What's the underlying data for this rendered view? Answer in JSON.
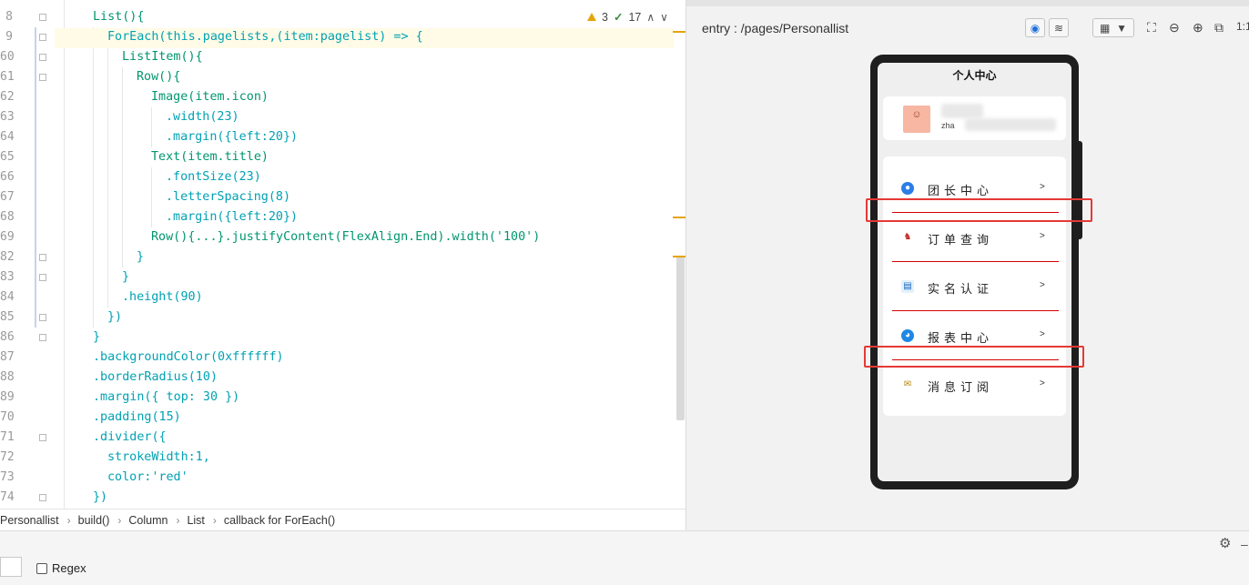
{
  "editor": {
    "status": {
      "warnings": "3",
      "checks": "17"
    },
    "lines": [
      {
        "no": "8",
        "html": "List(){"
      },
      {
        "no": "9",
        "html": "ForEach(this.pagelists,(item:pagelist) => {"
      },
      {
        "no": "60",
        "html": "ListItem(){"
      },
      {
        "no": "61",
        "html": "Row(){"
      },
      {
        "no": "62",
        "html": "Image(item.icon)"
      },
      {
        "no": "63",
        "html": ".width(23)"
      },
      {
        "no": "64",
        "html": ".margin({left:20})"
      },
      {
        "no": "65",
        "html": "Text(item.title)"
      },
      {
        "no": "66",
        "html": ".fontSize(23)"
      },
      {
        "no": "67",
        "html": ".letterSpacing(8)"
      },
      {
        "no": "68",
        "html": ".margin({left:20})"
      },
      {
        "no": "69",
        "html": "Row(){...}.justifyContent(FlexAlign.End).width('100')"
      },
      {
        "no": "82",
        "html": "}"
      },
      {
        "no": "83",
        "html": "}"
      },
      {
        "no": "84",
        "html": ".height(90)"
      },
      {
        "no": "85",
        "html": "})"
      },
      {
        "no": "86",
        "html": "}"
      },
      {
        "no": "87",
        "html": ".backgroundColor(0xffffff)"
      },
      {
        "no": "88",
        "html": ".borderRadius(10)"
      },
      {
        "no": "89",
        "html": ".margin({ top: 30 })"
      },
      {
        "no": "70",
        "html": ".padding(15)"
      },
      {
        "no": "71",
        "html": ".divider({"
      },
      {
        "no": "72",
        "html": "strokeWidth:1,"
      },
      {
        "no": "73",
        "html": "color:'red'"
      },
      {
        "no": "74",
        "html": "})"
      }
    ]
  },
  "breadcrumb": [
    "Personallist",
    "build()",
    "Column",
    "List",
    "callback for ForEach()"
  ],
  "findbar": {
    "regex_label": "Regex"
  },
  "preview": {
    "path": "entry : /pages/Personallist",
    "phone": {
      "title": "个人中心",
      "username": "zha",
      "menu": [
        {
          "label": "团长中心",
          "icon": "leader-icon",
          "arrow": ">"
        },
        {
          "label": "订单查询",
          "icon": "order-icon",
          "arrow": ">"
        },
        {
          "label": "实名认证",
          "icon": "id-card-icon",
          "arrow": ">"
        },
        {
          "label": "报表中心",
          "icon": "report-icon",
          "arrow": ">"
        },
        {
          "label": "消息订阅",
          "icon": "subscribe-icon",
          "arrow": ">"
        }
      ]
    }
  },
  "colors": {
    "divider": "#d40000",
    "highlight_box": "#e53935",
    "warning": "#e5a50a"
  }
}
